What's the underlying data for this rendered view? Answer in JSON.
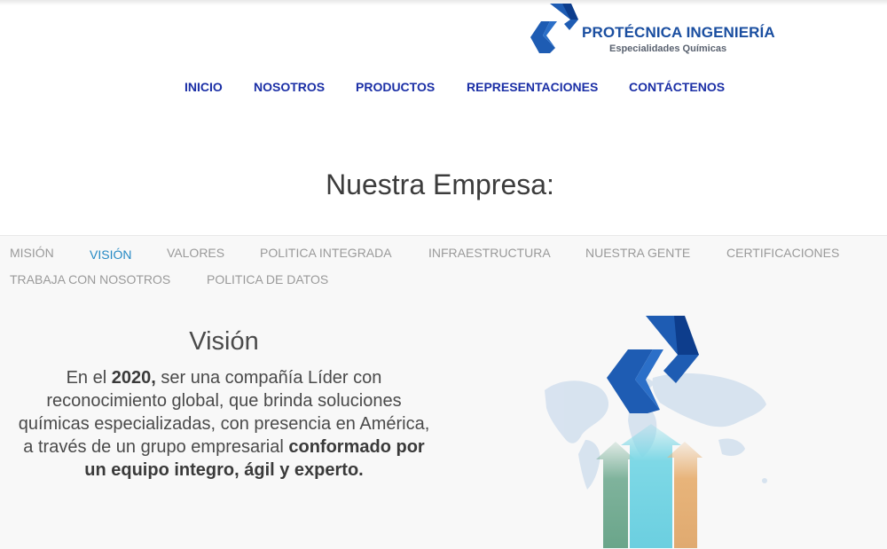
{
  "brand": {
    "name": "PROTÉCNICA INGENIERÍA",
    "subtitle": "Especialidades Químicas",
    "colors": {
      "primary": "#1a4ea0",
      "nav": "#1b2fa6",
      "active_tab": "#2589c4"
    }
  },
  "nav": {
    "items": [
      "INICIO",
      "NOSOTROS",
      "PRODUCTOS",
      "REPRESENTACIONES",
      "CONTÁCTENOS"
    ]
  },
  "section": {
    "title": "Nuestra Empresa:"
  },
  "tabs": {
    "items": [
      "MISIÓN",
      "VISIÓN",
      "VALORES",
      "POLITICA INTEGRADA",
      "INFRAESTRUCTURA",
      "NUESTRA GENTE",
      "CERTIFICACIONES",
      "TRABAJA CON NOSOTROS",
      "POLITICA DE DATOS"
    ],
    "active": "VISIÓN"
  },
  "vision": {
    "title": "Visión",
    "p1": "En el ",
    "year": "2020,",
    "p2": " ser una compañía Líder con reconocimiento global, que brinda soluciones químicas especializadas, con presencia en América, a través de un grupo empresarial ",
    "p3": "conformado por un equipo integro, ágil y experto."
  },
  "graphic": {
    "icon": "world-map-arrows-illustration"
  }
}
